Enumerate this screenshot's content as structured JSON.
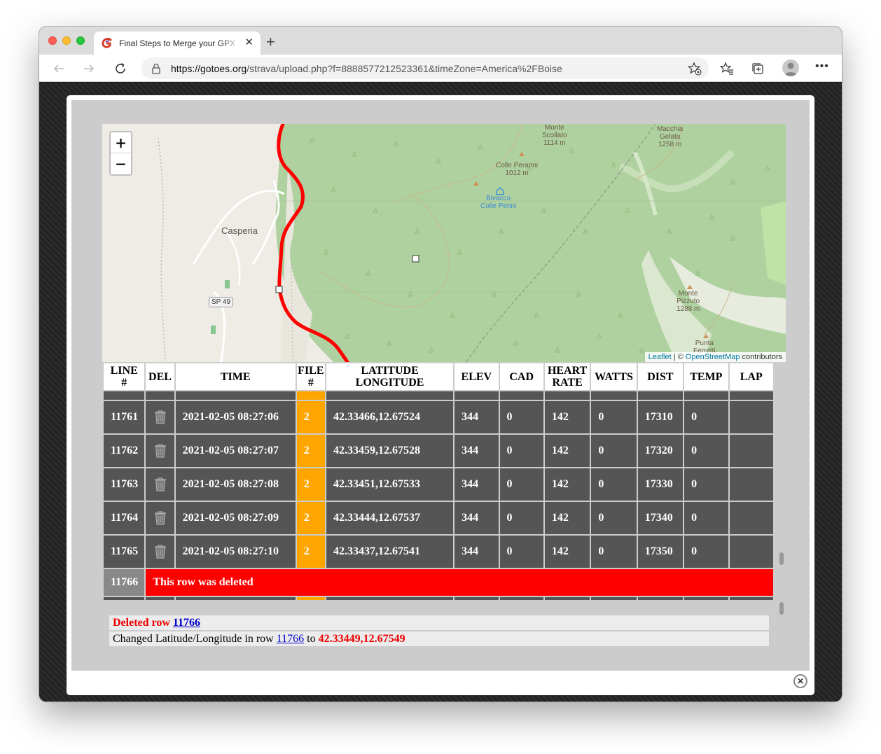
{
  "browser": {
    "tab_title": "Final Steps to Merge your GPX",
    "url_host": "https://gotoes.org",
    "url_path": "/strava/upload.php?f=8888577212523361&timeZone=America%2FBoise"
  },
  "map": {
    "zoom_in": "+",
    "zoom_out": "−",
    "labels": {
      "monte_scollato": "Monte\nScollato\n1114 m",
      "macchia_gelata": "Macchia\nGelata\n1258 m",
      "colle_perarini": "Colle Perarini\n1012 m",
      "bivacco": "Bivacco\nColle Perini",
      "casperia": "Casperia",
      "sp49": "SP 49",
      "monte_pizzuto": "Monte\nPizzuto\n1288 m",
      "punta_ferretti": "Punta\nFerretti"
    },
    "attribution": {
      "leaflet": "Leaflet",
      "sep": " | © ",
      "osm": "OpenStreetMap",
      "suffix": " contributors"
    }
  },
  "table": {
    "headers": [
      "LINE\n#",
      "DEL",
      "TIME",
      "FILE\n#",
      "LATITUDE\nLONGITUDE",
      "ELEV",
      "CAD",
      "HEART\nRATE",
      "WATTS",
      "DIST",
      "TEMP",
      "LAP"
    ],
    "rows": [
      {
        "line": "11761",
        "time": "2021-02-05 08:27:06",
        "file": "2",
        "latlon": "42.33466,12.67524",
        "elev": "344",
        "cad": "0",
        "hr": "142",
        "watts": "0",
        "dist": "17310",
        "temp": "0",
        "lap": ""
      },
      {
        "line": "11762",
        "time": "2021-02-05 08:27:07",
        "file": "2",
        "latlon": "42.33459,12.67528",
        "elev": "344",
        "cad": "0",
        "hr": "142",
        "watts": "0",
        "dist": "17320",
        "temp": "0",
        "lap": ""
      },
      {
        "line": "11763",
        "time": "2021-02-05 08:27:08",
        "file": "2",
        "latlon": "42.33451,12.67533",
        "elev": "344",
        "cad": "0",
        "hr": "142",
        "watts": "0",
        "dist": "17330",
        "temp": "0",
        "lap": ""
      },
      {
        "line": "11764",
        "time": "2021-02-05 08:27:09",
        "file": "2",
        "latlon": "42.33444,12.67537",
        "elev": "344",
        "cad": "0",
        "hr": "142",
        "watts": "0",
        "dist": "17340",
        "temp": "0",
        "lap": ""
      },
      {
        "line": "11765",
        "time": "2021-02-05 08:27:10",
        "file": "2",
        "latlon": "42.33437,12.67541",
        "elev": "344",
        "cad": "0",
        "hr": "142",
        "watts": "0",
        "dist": "17350",
        "temp": "0",
        "lap": ""
      }
    ],
    "deleted_row": {
      "line": "11766",
      "message": "This row was deleted"
    }
  },
  "log": {
    "deleted_prefix": "Deleted row ",
    "deleted_link": "11766",
    "changed_prefix": "Changed Latitude/Longitude in row ",
    "changed_link": "11766",
    "changed_mid": " to ",
    "changed_value": "42.33449,12.67549"
  },
  "colors": {
    "row_bg": "#555555",
    "file_col": "#ffa500",
    "deleted_bg": "#ff0000",
    "route": "#ff0000"
  }
}
